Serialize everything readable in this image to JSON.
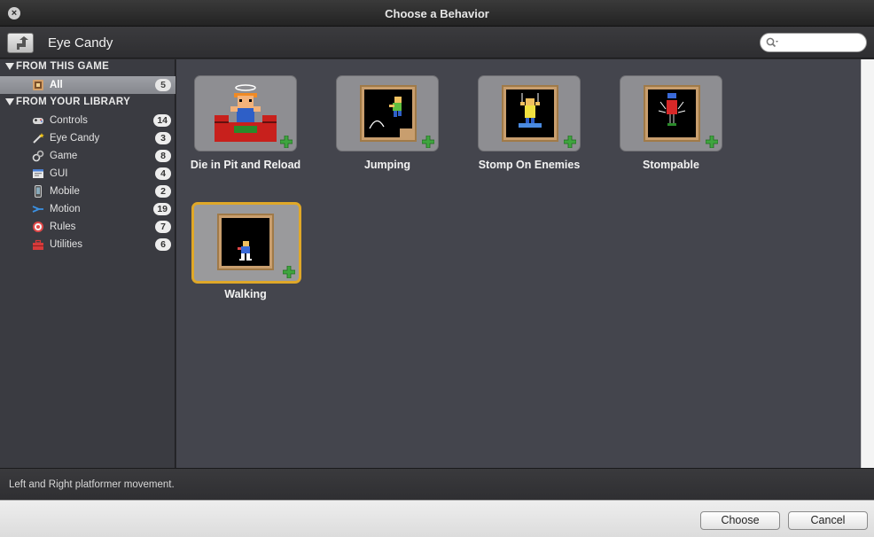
{
  "window": {
    "title": "Choose a Behavior"
  },
  "header": {
    "breadcrumb": "Eye Candy",
    "search_placeholder": ""
  },
  "sidebar": {
    "section_game": "FROM THIS GAME",
    "game_items": [
      {
        "label": "All",
        "count": "5",
        "icon": "all-icon"
      }
    ],
    "section_library": "FROM YOUR LIBRARY",
    "library_items": [
      {
        "label": "Controls",
        "count": "14",
        "icon": "gamepad-icon"
      },
      {
        "label": "Eye Candy",
        "count": "3",
        "icon": "magic-wand-icon"
      },
      {
        "label": "Game",
        "count": "8",
        "icon": "game-icon"
      },
      {
        "label": "GUI",
        "count": "4",
        "icon": "gui-icon"
      },
      {
        "label": "Mobile",
        "count": "2",
        "icon": "mobile-icon"
      },
      {
        "label": "Motion",
        "count": "19",
        "icon": "motion-icon"
      },
      {
        "label": "Rules",
        "count": "7",
        "icon": "target-icon"
      },
      {
        "label": "Utilities",
        "count": "6",
        "icon": "toolbox-icon"
      }
    ]
  },
  "behaviors": [
    {
      "name": "Die in Pit and Reload",
      "selected": false
    },
    {
      "name": "Jumping",
      "selected": false
    },
    {
      "name": "Stomp On Enemies",
      "selected": false
    },
    {
      "name": "Stompable",
      "selected": false
    },
    {
      "name": "Walking",
      "selected": true
    }
  ],
  "status": {
    "description": "Left and Right platformer movement."
  },
  "footer": {
    "choose_label": "Choose",
    "cancel_label": "Cancel"
  },
  "colors": {
    "selection_border": "#e0a828",
    "plus_badge": "#3fa53f"
  }
}
